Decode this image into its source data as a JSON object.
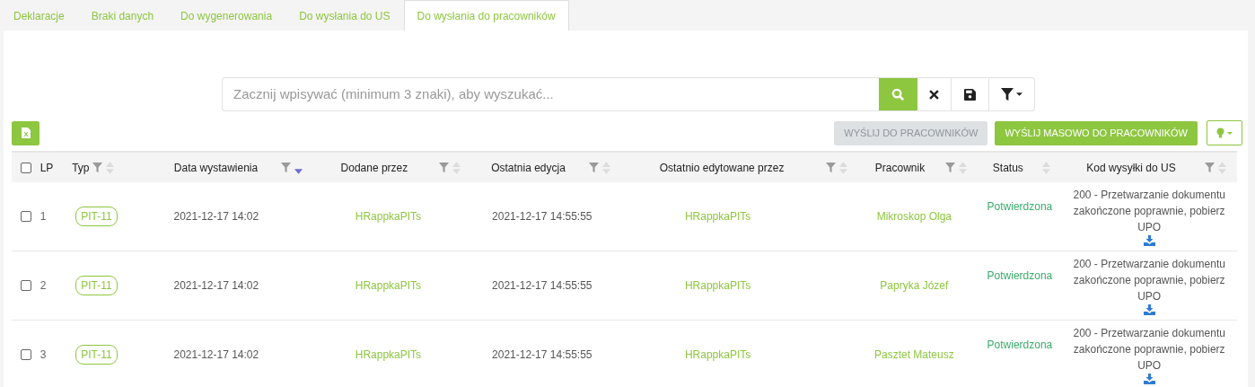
{
  "tabs": [
    {
      "label": "Deklaracje",
      "selected": false
    },
    {
      "label": "Braki danych",
      "selected": false
    },
    {
      "label": "Do wygenerowania",
      "selected": false
    },
    {
      "label": "Do wysłania do US",
      "selected": false
    },
    {
      "label": "Do wysłania do pracowników",
      "selected": true
    }
  ],
  "search": {
    "placeholder": "Zacznij wpisywać (minimum 3 znaki), aby wyszukać..."
  },
  "actions": [
    {
      "label": "WYŚLIJ DO PRACOWNIKÓW",
      "disabled": true
    },
    {
      "label": "WYŚLIJ MASOWO DO PRACOWNIKÓW",
      "disabled": false
    }
  ],
  "table": {
    "select_all": {
      "checked": false
    },
    "columns": [
      {
        "label": "LP"
      },
      {
        "label": "Typ",
        "filter": true,
        "sorted": false,
        "sortable": true
      },
      {
        "label": "Data wystawienia",
        "filter": true,
        "sorted": true,
        "sortable": true
      },
      {
        "label": "Dodane przez",
        "filter": true,
        "sorted": false,
        "sortable": true
      },
      {
        "label": "Ostatnia edycja",
        "filter": true,
        "sorted": false,
        "sortable": true
      },
      {
        "label": "Ostatnio edytowane przez",
        "filter": true,
        "sorted": false,
        "sortable": true
      },
      {
        "label": "Pracownik",
        "filter": true,
        "sorted": false,
        "sortable": true
      },
      {
        "label": "Status",
        "filter": false,
        "sorted": false,
        "sortable": true
      },
      {
        "label": "Kod wysyłki do US",
        "filter": true,
        "sorted": false,
        "sortable": true
      }
    ],
    "rows": [
      {
        "checked": false,
        "lp": "1",
        "type": "PIT-11",
        "issued": "2021-12-17 14:02",
        "added_by": "HRappkaPITs",
        "last_edit": "2021-12-17 14:55:55",
        "edited_by": "HRappkaPITs",
        "employee": "Mikroskop Olga",
        "status": "Potwierdzona",
        "code": "200 - Przetwarzanie dokumentu zakończone poprawnie, pobierz UPO"
      },
      {
        "checked": false,
        "lp": "2",
        "type": "PIT-11",
        "issued": "2021-12-17 14:02",
        "added_by": "HRappkaPITs",
        "last_edit": "2021-12-17 14:55:55",
        "edited_by": "HRappkaPITs",
        "employee": "Papryka Józef",
        "status": "Potwierdzona",
        "code": "200 - Przetwarzanie dokumentu zakończone poprawnie, pobierz UPO"
      },
      {
        "checked": false,
        "lp": "3",
        "type": "PIT-11",
        "issued": "2021-12-17 14:02",
        "added_by": "HRappkaPITs",
        "last_edit": "2021-12-17 14:55:55",
        "edited_by": "HRappkaPITs",
        "employee": "Pasztet Mateusz",
        "status": "Potwierdzona",
        "code": "200 - Przetwarzanie dokumentu zakończone poprawnie, pobierz UPO"
      }
    ]
  }
}
